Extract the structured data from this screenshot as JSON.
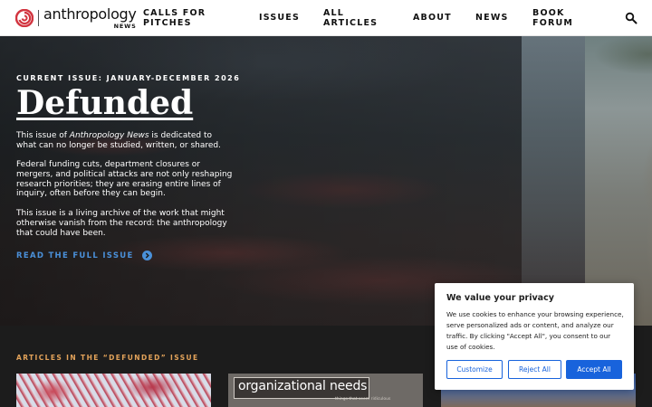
{
  "header": {
    "logo": {
      "name": "anthropology",
      "sub": "NEWS"
    },
    "nav": {
      "calls": "CALLS FOR PITCHES",
      "issues": "ISSUES",
      "all_articles": "ALL ARTICLES",
      "about": "ABOUT",
      "news": "NEWS",
      "book_forum": "BOOK FORUM"
    },
    "search_icon": "search-icon"
  },
  "hero": {
    "eyebrow": "CURRENT ISSUE: JANUARY-DECEMBER 2026",
    "title": "Defunded",
    "p1_before": "This issue of ",
    "p1_em": "Anthropology News",
    "p1_after": " is dedicated to what can no longer be studied, written, or shared.",
    "p2": "Federal funding cuts, department closures or mergers, and political attacks are not only reshaping research priorities; they are erasing entire lines of inquiry, often before they can begin.",
    "p3": "This issue is a living archive of the work that might otherwise vanish from the record: the anthropology that could have been.",
    "cta": "READ THE FULL ISSUE",
    "cta_icon": "chevron-right-circle-icon"
  },
  "articles": {
    "label": "ARTICLES IN THE “DEFUNDED” ISSUE",
    "card2_text": "organizational needs",
    "card2_small": "things that seem ridiculous"
  },
  "cookie": {
    "title": "We value your privacy",
    "body": "We use cookies to enhance your browsing experience, serve personalized ads or content, and analyze our traffic. By clicking \"Accept All\", you consent to our use of cookies.",
    "customize": "Customize",
    "reject": "Reject All",
    "accept": "Accept All"
  },
  "colors": {
    "accent_blue": "#4a90d9",
    "eyebrow_orange": "#e3a35a",
    "cookie_blue": "#1863dc",
    "logo_red": "#d2343f"
  }
}
